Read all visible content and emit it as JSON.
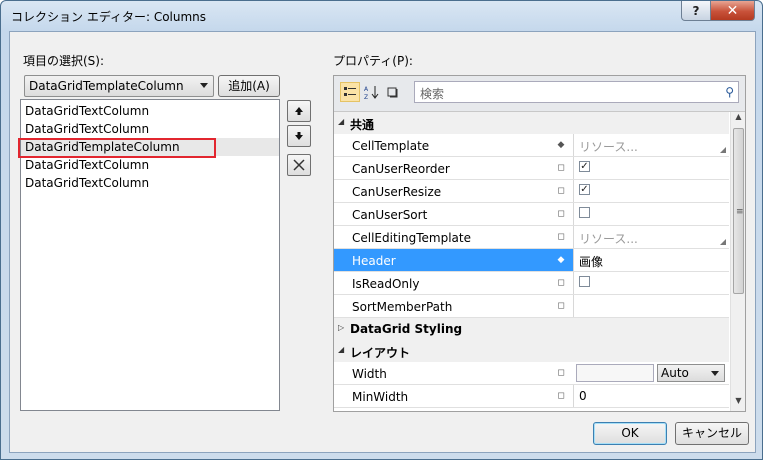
{
  "window": {
    "title": "コレクション エディター: Columns",
    "help_glyph": "?",
    "close_glyph": "✕"
  },
  "left": {
    "items_label": "項目の選択(S):",
    "type_select_value": "DataGridTemplateColumn",
    "add_button": "追加(A)",
    "items": [
      {
        "label": "DataGridTextColumn",
        "selected": false
      },
      {
        "label": "DataGridTextColumn",
        "selected": false
      },
      {
        "label": "DataGridTemplateColumn",
        "selected": true
      },
      {
        "label": "DataGridTextColumn",
        "selected": false
      },
      {
        "label": "DataGridTextColumn",
        "selected": false
      }
    ],
    "move_up_icon": "arrow-up-icon",
    "move_down_icon": "arrow-down-icon",
    "delete_icon": "delete-x-icon"
  },
  "properties": {
    "label": "プロパティ(P):",
    "search_placeholder": "検索",
    "categories": {
      "common": "共通",
      "styling": "DataGrid Styling",
      "layout": "レイアウト"
    },
    "rows": {
      "cell_template": {
        "name": "CellTemplate",
        "value": "リソース..."
      },
      "can_user_reorder": {
        "name": "CanUserReorder",
        "checked": true
      },
      "can_user_resize": {
        "name": "CanUserResize",
        "checked": true
      },
      "can_user_sort": {
        "name": "CanUserSort",
        "checked": false
      },
      "cell_editing_template": {
        "name": "CellEditingTemplate",
        "value": "リソース..."
      },
      "header": {
        "name": "Header",
        "value": "画像"
      },
      "is_read_only": {
        "name": "IsReadOnly",
        "checked": false
      },
      "sort_member_path": {
        "name": "SortMemberPath",
        "value": ""
      },
      "width": {
        "name": "Width",
        "value": "",
        "unit": "Auto"
      },
      "min_width": {
        "name": "MinWidth",
        "value": "0"
      }
    }
  },
  "footer": {
    "ok": "OK",
    "cancel": "キャンセル"
  },
  "colors": {
    "selection": "#3399ff",
    "highlight_border": "#e2262f"
  }
}
